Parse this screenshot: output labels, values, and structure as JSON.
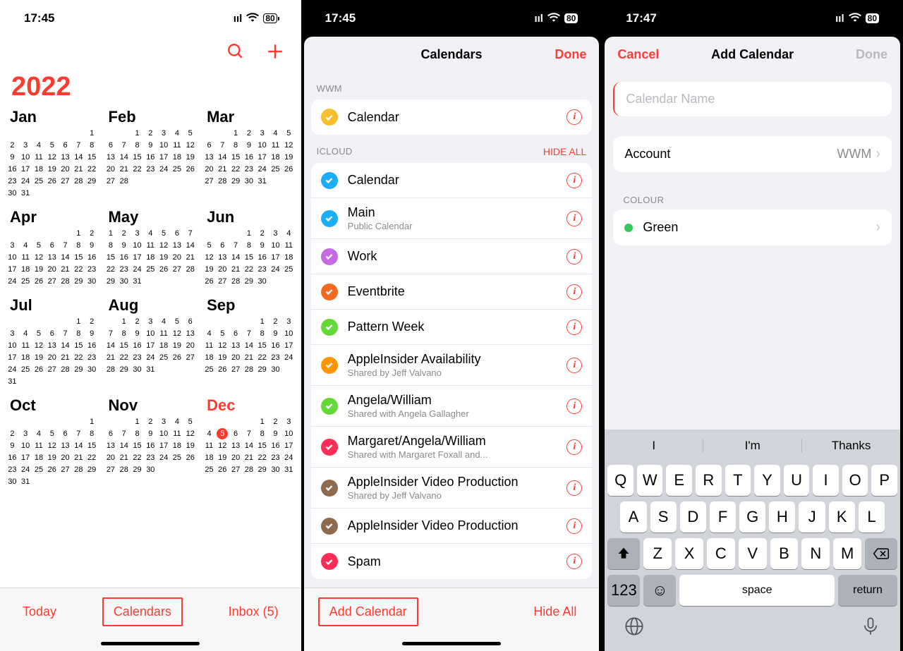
{
  "status": {
    "time1": "17:45",
    "time2": "17:45",
    "time3": "17:47",
    "battery": "80"
  },
  "panel1": {
    "year": "2022",
    "today_button": "Today",
    "calendars_button": "Calendars",
    "inbox_button": "Inbox (5)",
    "today": {
      "month": 12,
      "day": 5
    },
    "months": [
      {
        "name": "Jan",
        "first_dow": 6,
        "days": 31
      },
      {
        "name": "Feb",
        "first_dow": 2,
        "days": 28
      },
      {
        "name": "Mar",
        "first_dow": 2,
        "days": 31
      },
      {
        "name": "Apr",
        "first_dow": 5,
        "days": 30
      },
      {
        "name": "May",
        "first_dow": 0,
        "days": 31
      },
      {
        "name": "Jun",
        "first_dow": 3,
        "days": 30
      },
      {
        "name": "Jul",
        "first_dow": 5,
        "days": 31
      },
      {
        "name": "Aug",
        "first_dow": 1,
        "days": 31
      },
      {
        "name": "Sep",
        "first_dow": 4,
        "days": 30
      },
      {
        "name": "Oct",
        "first_dow": 6,
        "days": 31
      },
      {
        "name": "Nov",
        "first_dow": 2,
        "days": 30
      },
      {
        "name": "Dec",
        "first_dow": 4,
        "days": 31
      }
    ]
  },
  "panel2": {
    "title": "Calendars",
    "done": "Done",
    "add_button": "Add Calendar",
    "hide_all_button": "Hide All",
    "sections": [
      {
        "header": "WWM",
        "hide": "",
        "items": [
          {
            "name": "Calendar",
            "sub": "",
            "color": "#f7bf2f"
          }
        ]
      },
      {
        "header": "ICLOUD",
        "hide": "HIDE ALL",
        "items": [
          {
            "name": "Calendar",
            "sub": "",
            "color": "#1badf8"
          },
          {
            "name": "Main",
            "sub": "Public Calendar",
            "color": "#1badf8"
          },
          {
            "name": "Work",
            "sub": "",
            "color": "#c56ae0"
          },
          {
            "name": "Eventbrite",
            "sub": "",
            "color": "#f26b21"
          },
          {
            "name": "Pattern Week",
            "sub": "",
            "color": "#63da38"
          },
          {
            "name": "AppleInsider Availability",
            "sub": "Shared by Jeff Valvano",
            "color": "#ff9500"
          },
          {
            "name": "Angela/William",
            "sub": "Shared with Angela Gallagher",
            "color": "#63da38"
          },
          {
            "name": "Margaret/Angela/William",
            "sub": "Shared with Margaret Foxall and...",
            "color": "#ff2d55"
          },
          {
            "name": "AppleInsider Video Production",
            "sub": "Shared by Jeff Valvano",
            "color": "#8e6b4e"
          },
          {
            "name": "AppleInsider Video Production",
            "sub": "",
            "color": "#8e6b4e"
          },
          {
            "name": "Spam",
            "sub": "",
            "color": "#ff2d55"
          }
        ]
      }
    ]
  },
  "panel3": {
    "cancel": "Cancel",
    "title": "Add Calendar",
    "done": "Done",
    "name_placeholder": "Calendar Name",
    "account_label": "Account",
    "account_value": "WWM",
    "colour_header": "COLOUR",
    "colour_value": "Green",
    "colour_hex": "#34c759",
    "keyboard": {
      "suggestions": [
        "I",
        "I'm",
        "Thanks"
      ],
      "rows": [
        [
          "Q",
          "W",
          "E",
          "R",
          "T",
          "Y",
          "U",
          "I",
          "O",
          "P"
        ],
        [
          "A",
          "S",
          "D",
          "F",
          "G",
          "H",
          "J",
          "K",
          "L"
        ],
        [
          "Z",
          "X",
          "C",
          "V",
          "B",
          "N",
          "M"
        ]
      ],
      "num": "123",
      "space": "space",
      "return": "return"
    }
  }
}
